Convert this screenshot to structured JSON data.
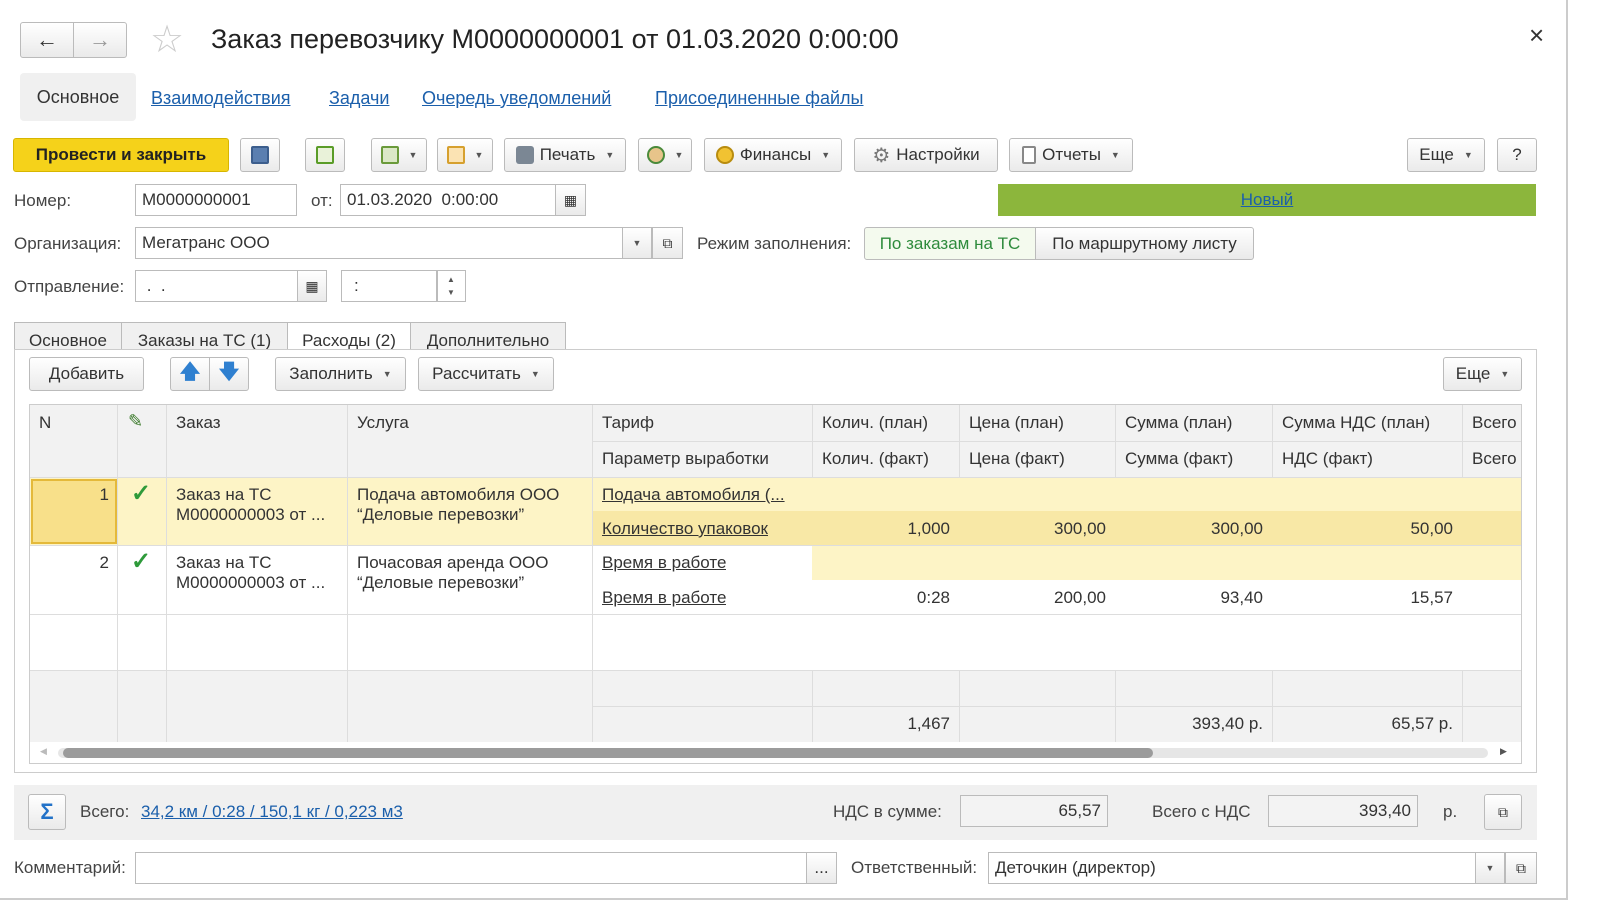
{
  "window": {
    "title": "Заказ перевозчику М0000000001 от 01.03.2020 0:00:00",
    "close": "×"
  },
  "nav": {
    "back": "←",
    "forward": "→",
    "star": "☆"
  },
  "top_tabs": [
    "Основное",
    "Взаимодействия",
    "Задачи",
    "Очередь уведомлений",
    "Присоединенные файлы"
  ],
  "toolbar": {
    "post_close": "Провести и закрыть",
    "print": "Печать",
    "finance": "Финансы",
    "settings": "Настройки",
    "reports": "Отчеты",
    "more": "Еще",
    "help": "?"
  },
  "header": {
    "number_label": "Номер:",
    "number_value": "М0000000001",
    "date_label": "от:",
    "date_value": "01.03.2020  0:00:00",
    "status": "Новый",
    "org_label": "Организация:",
    "org_value": "Мегатранс ООО",
    "fill_mode_label": "Режим заполнения:",
    "fill_mode_options": [
      "По заказам на ТС",
      "По маршрутному листу"
    ],
    "departure_label": "Отправление:",
    "departure_date": " .  .",
    "departure_time": ":"
  },
  "inner_tabs": [
    "Основное",
    "Заказы на ТС (1)",
    "Расходы (2)",
    "Дополнительно"
  ],
  "table_toolbar": {
    "add": "Добавить",
    "fill": "Заполнить",
    "calculate": "Рассчитать",
    "more": "Еще"
  },
  "table": {
    "headers_row1": [
      "N",
      "",
      "Заказ",
      "Услуга",
      "Тариф",
      "Колич. (план)",
      "Цена (план)",
      "Сумма (план)",
      "Сумма НДС (план)",
      "Всего"
    ],
    "headers_row2": [
      "Параметр выработки",
      "Колич. (факт)",
      "Цена (факт)",
      "Сумма (факт)",
      "НДС (факт)",
      "Всего"
    ],
    "rows": [
      {
        "n": "1",
        "check": "✓",
        "order": "Заказ на ТС М0000000003 от ...",
        "service": "Подача автомобиля ООО “Деловые перевозки”",
        "tariff": "Подача автомобиля (...",
        "param": "Количество упаковок",
        "qty_fact": "1,000",
        "price_fact": "300,00",
        "sum_fact": "300,00",
        "vat_fact": "50,00"
      },
      {
        "n": "2",
        "check": "✓",
        "order": "Заказ на ТС М0000000003 от ...",
        "service": "Почасовая аренда ООО “Деловые перевозки”",
        "tariff": "Время в работе",
        "param": "Время в работе",
        "qty_fact": "0:28",
        "price_fact": "200,00",
        "sum_fact": "93,40",
        "vat_fact": "15,57"
      }
    ],
    "totals": {
      "qty": "1,467",
      "sum": "393,40 р.",
      "vat": "65,57 р."
    }
  },
  "footer": {
    "sigma": "Σ",
    "total_label": "Всего:",
    "total_link": "34,2 км / 0:28 / 150,1 кг / 0,223 м3",
    "vat_label": "НДС в сумме:",
    "vat_value": "65,57",
    "total_vat_label": "Всего с НДС",
    "total_vat_value": "393,40",
    "currency": "р.",
    "comment_label": "Комментарий:",
    "comment_btn": "...",
    "responsible_label": "Ответственный:",
    "responsible_value": "Деточкин (директор)"
  },
  "colors": {
    "accent_yellow": "#f5d21a",
    "status_green": "#8cb63c",
    "row_highlight": "#fdf4c6",
    "link": "#1b5fab"
  }
}
